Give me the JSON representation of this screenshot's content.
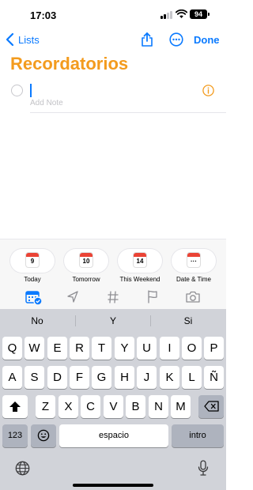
{
  "status": {
    "time": "17:03",
    "battery": "94"
  },
  "nav": {
    "back_label": "Lists",
    "done_label": "Done"
  },
  "list_title": "Recordatorios",
  "reminder": {
    "title_value": "",
    "note_placeholder": "Add Note"
  },
  "quick_dates": [
    {
      "label": "Today",
      "icon_text": "9"
    },
    {
      "label": "Tomorrow",
      "icon_text": "10"
    },
    {
      "label": "This Weekend",
      "icon_text": "14"
    },
    {
      "label": "Date & Time",
      "icon_text": "···"
    }
  ],
  "toolbar_icons": [
    "calendar-icon",
    "location-icon",
    "tag-icon",
    "flag-icon",
    "camera-icon"
  ],
  "keyboard": {
    "predictions": [
      "No",
      "Y",
      "Si"
    ],
    "row1": [
      "Q",
      "W",
      "E",
      "R",
      "T",
      "Y",
      "U",
      "I",
      "O",
      "P"
    ],
    "row2": [
      "A",
      "S",
      "D",
      "F",
      "G",
      "H",
      "J",
      "K",
      "L",
      "Ñ"
    ],
    "row3": [
      "Z",
      "X",
      "C",
      "V",
      "B",
      "N",
      "M"
    ],
    "numbers_label": "123",
    "space_label": "espacio",
    "return_label": "intro"
  },
  "colors": {
    "accent": "#0a7aff",
    "title": "#f39b1e",
    "calendar_red": "#ea4335"
  }
}
